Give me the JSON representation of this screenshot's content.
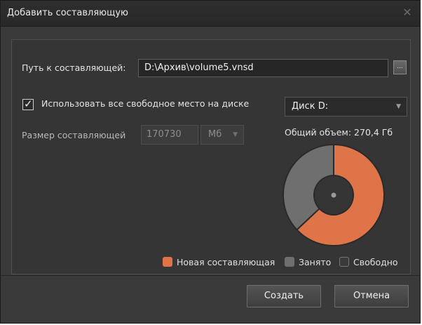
{
  "dialog": {
    "title": "Добавить составляющую",
    "close_icon": "close-icon"
  },
  "form": {
    "path_label": "Путь к составляющей:",
    "path_value": "D:\\Архив\\volume5.vnsd",
    "browse_label": "...",
    "use_all_space_label": "Использовать все свободное место на диске",
    "use_all_space_checked": true,
    "checkmark": "✓",
    "disk_value": "Диск D:",
    "size_label": "Размер составляющей",
    "size_value": "170730",
    "unit_value": "Мб",
    "total_label": "Общий объем: 270,4 Гб"
  },
  "chart_data": {
    "type": "pie",
    "title": "Общий объем: 270,4 Гб",
    "categories": [
      "Новая составляющая",
      "Занято",
      "Свободно"
    ],
    "values": [
      0.63,
      0.37,
      0.0
    ],
    "colors": [
      "#de7447",
      "#6f6f6f",
      "#3a3a3a"
    ],
    "legend_position": "bottom"
  },
  "legend": {
    "new_label": "Новая составляющая",
    "used_label": "Занято",
    "free_label": "Свободно",
    "colors": {
      "new": "#de7447",
      "used": "#6f6f6f",
      "free": "#3a3a3a"
    }
  },
  "buttons": {
    "create": "Создать",
    "cancel": "Отмена"
  }
}
